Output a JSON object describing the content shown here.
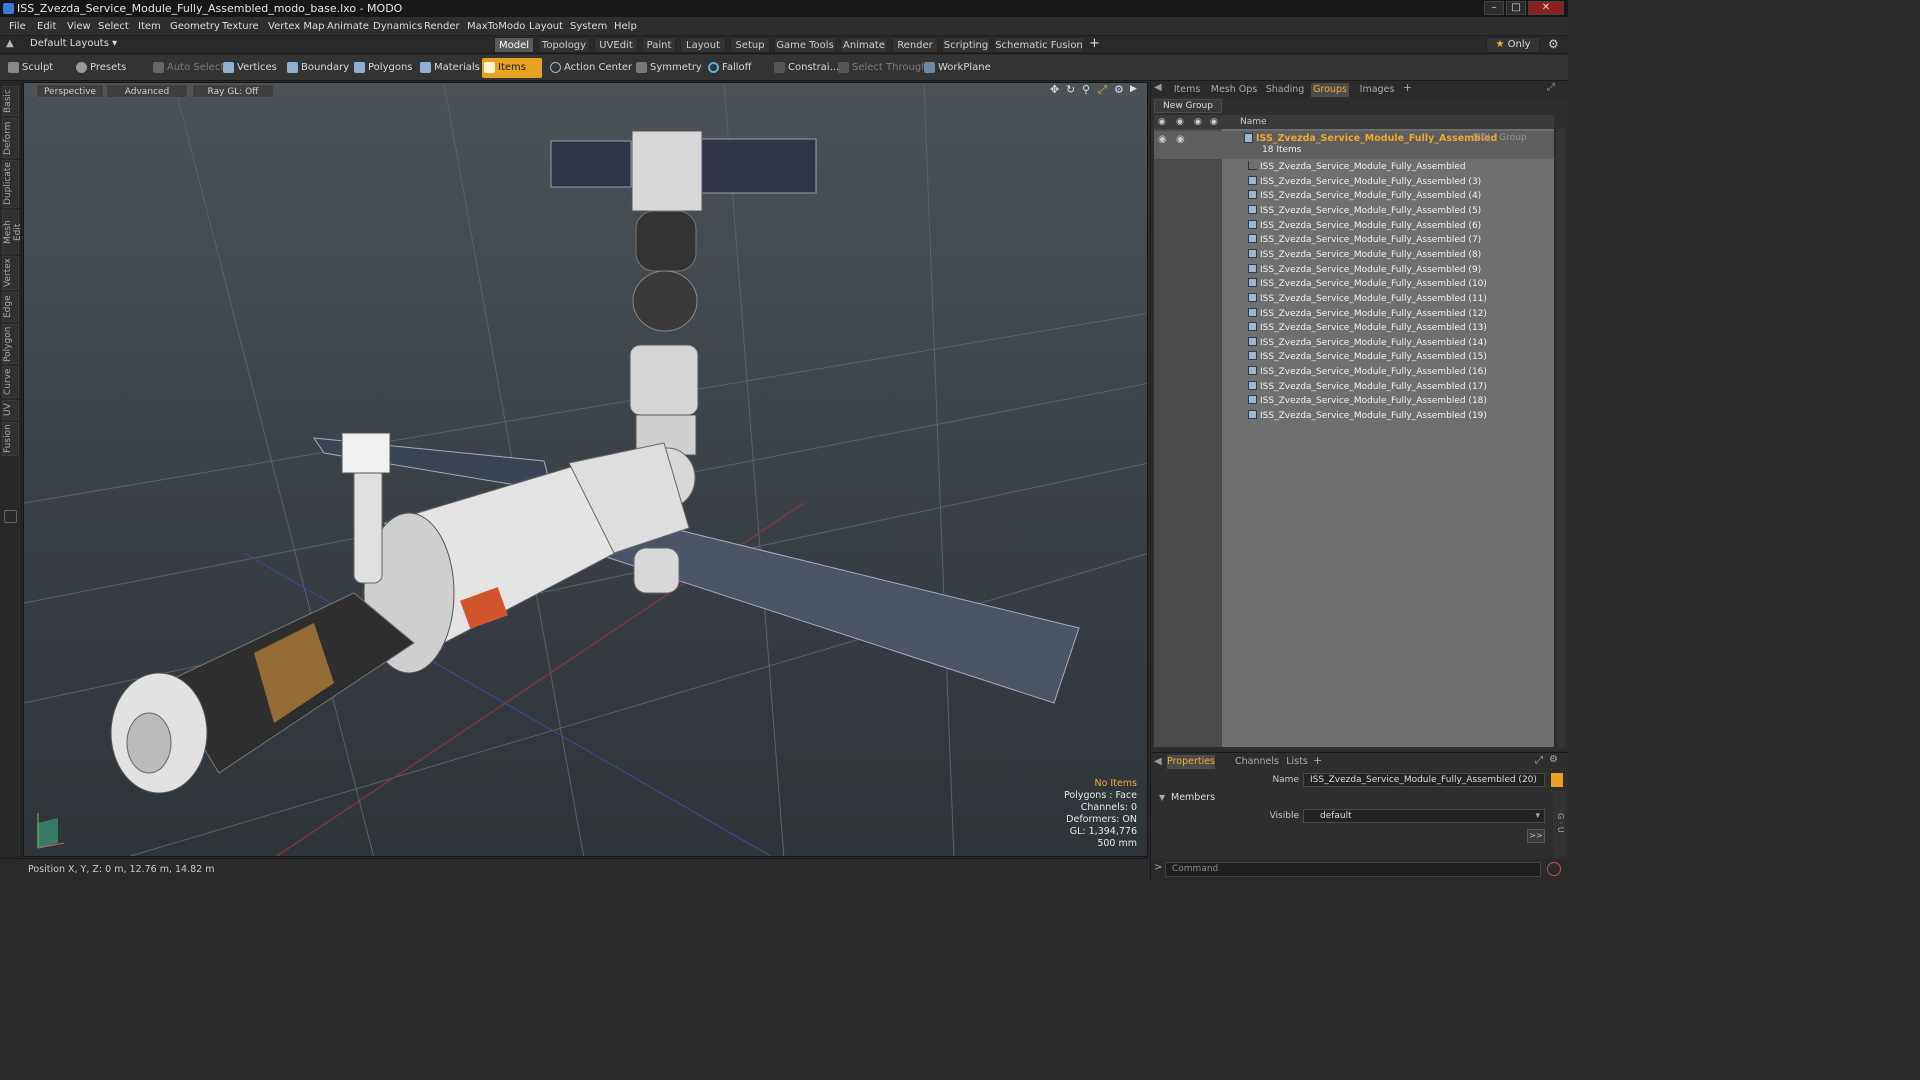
{
  "window": {
    "title": "ISS_Zvezda_Service_Module_Fully_Assembled_modo_base.lxo - MODO"
  },
  "menu": [
    "File",
    "Edit",
    "View",
    "Select",
    "Item",
    "Geometry",
    "Texture",
    "Vertex Map",
    "Animate",
    "Dynamics",
    "Render",
    "MaxToModo",
    "Layout",
    "System",
    "Help"
  ],
  "layout_selector": "Default Layouts",
  "layout_tabs": [
    {
      "label": "Model",
      "active": true
    },
    {
      "label": "Topology",
      "active": false
    },
    {
      "label": "UVEdit",
      "active": false
    },
    {
      "label": "Paint",
      "active": false
    },
    {
      "label": "Layout",
      "active": false
    },
    {
      "label": "Setup",
      "active": false
    },
    {
      "label": "Game Tools",
      "active": false
    },
    {
      "label": "Animate",
      "active": false
    },
    {
      "label": "Render",
      "active": false
    },
    {
      "label": "Scripting",
      "active": false
    },
    {
      "label": "Schematic Fusion",
      "active": false
    }
  ],
  "only_label": "Only",
  "toolbar": {
    "sculpt": "Sculpt",
    "presets": "Presets",
    "auto_select": "Auto Select",
    "vertices": "Vertices",
    "boundary": "Boundary",
    "polygons": "Polygons",
    "materials": "Materials",
    "items": "Items",
    "action_center": "Action Center",
    "symmetry": "Symmetry",
    "falloff": "Falloff",
    "constraints": "Constrai...",
    "select_through": "Select Through",
    "workplane": "WorkPlane"
  },
  "left_tabs": [
    "Basic",
    "Deform",
    "Duplicate",
    "Mesh Edit",
    "Vertex",
    "Edge",
    "Polygon",
    "Curve",
    "UV",
    "Fusion"
  ],
  "viewport": {
    "view_mode": "Perspective",
    "shading": "Advanced",
    "raygl": "Ray GL: Off",
    "hud": {
      "items": "No Items",
      "polygons": "Polygons : Face",
      "channels": "Channels: 0",
      "deformers": "Deformers: ON",
      "gl": "GL: 1,394,776",
      "scale": "500 mm"
    },
    "accent": "#f0b030"
  },
  "status": {
    "position": "Position X, Y, Z:  0 m, 12.76 m, 14.82 m"
  },
  "right_panel": {
    "tabs": [
      {
        "label": "Items",
        "active": false
      },
      {
        "label": "Mesh Ops",
        "active": false
      },
      {
        "label": "Shading",
        "active": false
      },
      {
        "label": "Groups",
        "active": true
      },
      {
        "label": "Images",
        "active": false
      }
    ],
    "new_group": "New Group",
    "column_name": "Name",
    "group": {
      "name": "ISS_Zvezda_Service_Module_Fully_Assembled",
      "suffix": "(20) : Group",
      "count": "18 Items"
    },
    "items": [
      "ISS_Zvezda_Service_Module_Fully_Assembled",
      "ISS_Zvezda_Service_Module_Fully_Assembled (3)",
      "ISS_Zvezda_Service_Module_Fully_Assembled (4)",
      "ISS_Zvezda_Service_Module_Fully_Assembled (5)",
      "ISS_Zvezda_Service_Module_Fully_Assembled (6)",
      "ISS_Zvezda_Service_Module_Fully_Assembled (7)",
      "ISS_Zvezda_Service_Module_Fully_Assembled (8)",
      "ISS_Zvezda_Service_Module_Fully_Assembled (9)",
      "ISS_Zvezda_Service_Module_Fully_Assembled (10)",
      "ISS_Zvezda_Service_Module_Fully_Assembled (11)",
      "ISS_Zvezda_Service_Module_Fully_Assembled (12)",
      "ISS_Zvezda_Service_Module_Fully_Assembled (13)",
      "ISS_Zvezda_Service_Module_Fully_Assembled (14)",
      "ISS_Zvezda_Service_Module_Fully_Assembled (15)",
      "ISS_Zvezda_Service_Module_Fully_Assembled (16)",
      "ISS_Zvezda_Service_Module_Fully_Assembled (17)",
      "ISS_Zvezda_Service_Module_Fully_Assembled (18)",
      "ISS_Zvezda_Service_Module_Fully_Assembled (19)"
    ]
  },
  "properties": {
    "tabs": [
      {
        "label": "Properties",
        "active": true
      },
      {
        "label": "Channels",
        "active": false
      },
      {
        "label": "Lists",
        "active": false
      }
    ],
    "name_label": "Name",
    "name_value": "ISS_Zvezda_Service_Module_Fully_Assembled (20)",
    "members_label": "Members",
    "visible_label": "Visible",
    "visible_value": "default"
  },
  "command": {
    "placeholder": "Command"
  }
}
